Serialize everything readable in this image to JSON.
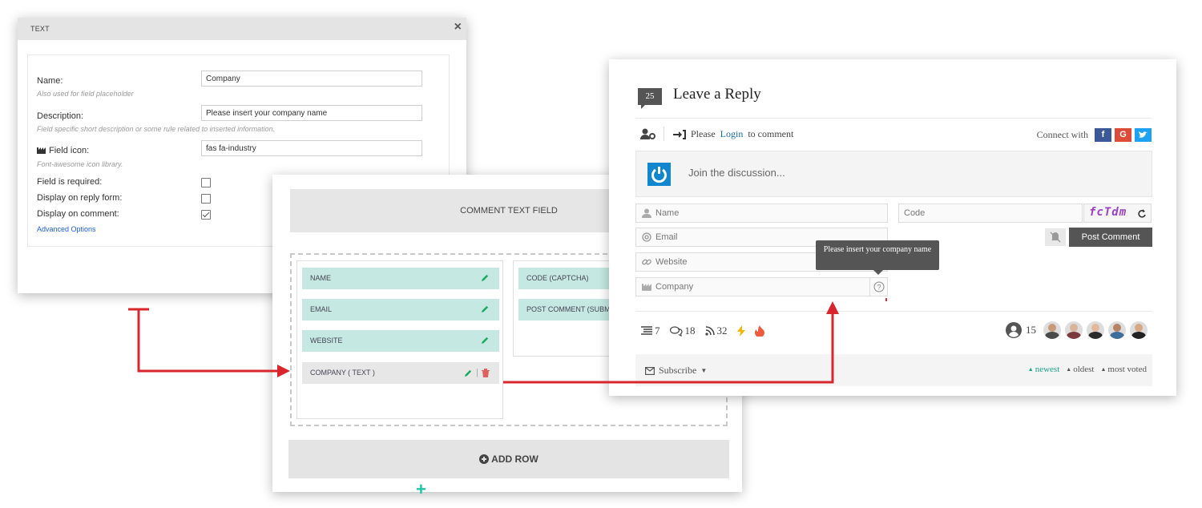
{
  "dialog": {
    "title": "TEXT",
    "close": "×",
    "name_label": "Name:",
    "name_note": "Also used for field placeholder",
    "name_value": "Company",
    "description_label": "Description:",
    "description_note": "Field specific short description or some rule related to inserted information.",
    "description_value": "Please insert your company name",
    "icon_label": "Field icon:",
    "icon_note": "Font-awesome icon library.",
    "icon_value": "fas fa-industry",
    "required_label": "Field is required:",
    "required_checked": false,
    "reply_label": "Display on reply form:",
    "reply_checked": false,
    "display_comment_label": "Display on comment:",
    "display_comment_checked": true,
    "advanced": "Advanced Options"
  },
  "builder": {
    "header": "COMMENT TEXT FIELD",
    "col1": [
      {
        "label": "NAME"
      },
      {
        "label": "EMAIL"
      },
      {
        "label": "WEBSITE"
      },
      {
        "label": "COMPANY ( TEXT )"
      }
    ],
    "col2": [
      {
        "label": "CODE (CAPTCHA)"
      },
      {
        "label": "POST COMMENT (SUBM"
      }
    ],
    "add_field": "+",
    "add_row": "ADD ROW",
    "accent": "#1ec6a8"
  },
  "preview": {
    "count": "25",
    "title": "Leave a Reply",
    "login_pre": "Please",
    "login_link": "Login",
    "login_post": "to comment",
    "connect": "Connect with",
    "social": [
      {
        "label": "f",
        "color": "#3b5998"
      },
      {
        "label": "G",
        "color": "#dd4b39"
      },
      {
        "label": "🐦",
        "color": "#1da1f2"
      }
    ],
    "discussion_placeholder": "Join the discussion...",
    "name_placeholder": "Name",
    "email_placeholder": "Email",
    "website_placeholder": "Website",
    "company_placeholder": "Company",
    "code_placeholder": "Code",
    "captcha": "fcTdm",
    "post_comment": "Post Comment",
    "tooltip": "Please insert your company name",
    "stats": {
      "threads": "7",
      "replies": "18",
      "followers": "32"
    },
    "users_count": "15",
    "subscribe": "Subscribe",
    "sort": [
      "newest",
      "oldest",
      "most voted"
    ],
    "accent": "#1aa189"
  },
  "arrow_color": "#d9262c"
}
